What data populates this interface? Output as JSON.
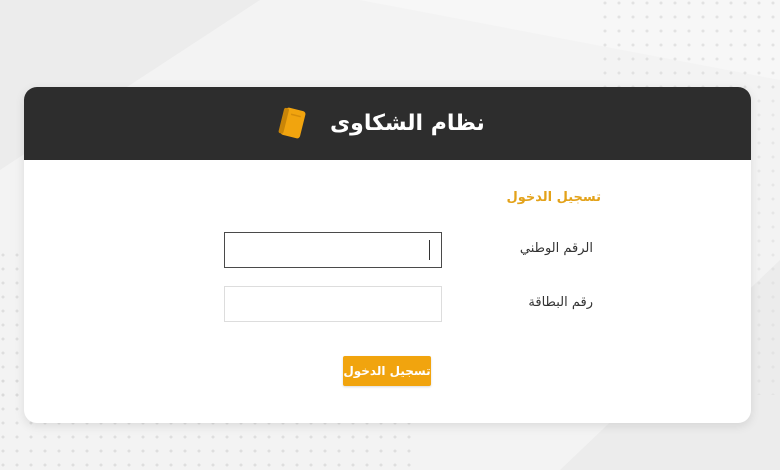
{
  "header": {
    "title": "نظام الشكاوى",
    "logo_icon": "book-icon",
    "background_color": "#2d2d2d"
  },
  "form": {
    "section_title": "تسجيل الدخول",
    "national_id": {
      "label": "الرقم الوطني",
      "value": "",
      "placeholder": ""
    },
    "card_number": {
      "label": "رقم البطاقة",
      "value": "",
      "placeholder": ""
    },
    "submit_label": "تسجيل الدخول"
  },
  "colors": {
    "accent": "#f1a40e",
    "section_title": "#e3a21a",
    "page_background": "#f1f1f1"
  }
}
